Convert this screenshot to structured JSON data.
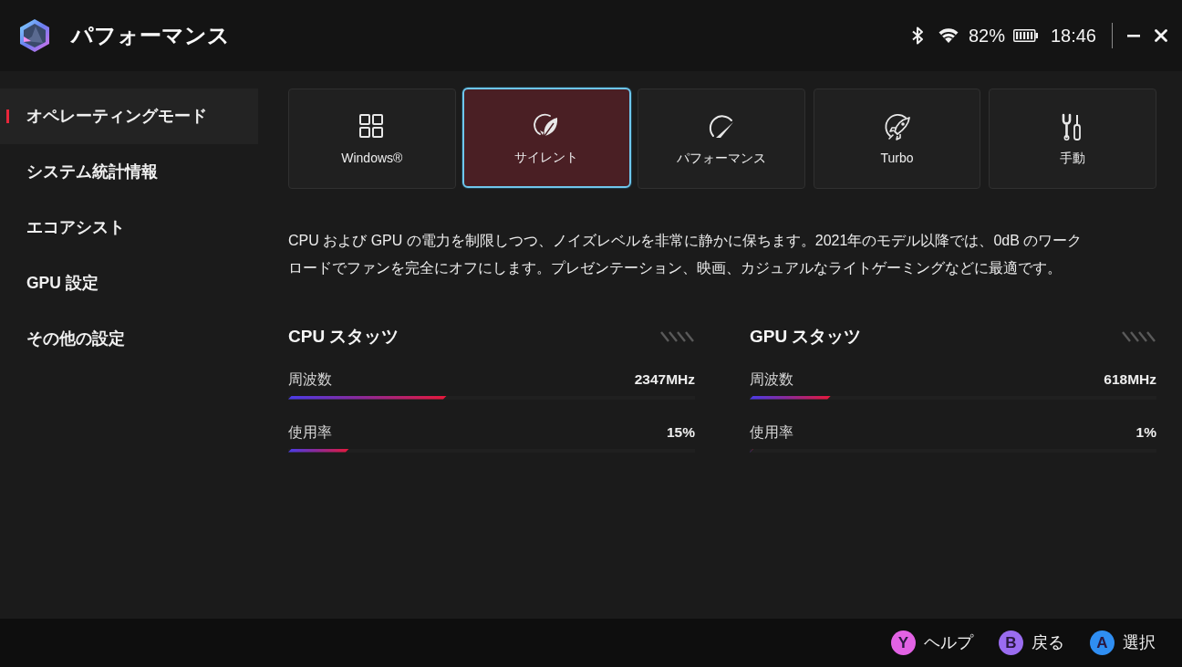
{
  "app": {
    "title": "パフォーマンス"
  },
  "status_bar": {
    "battery": "82%",
    "time": "18:46"
  },
  "sidebar": {
    "items": [
      {
        "label": "オペレーティングモード",
        "selected": true
      },
      {
        "label": "システム統計情報",
        "selected": false
      },
      {
        "label": "エコアシスト",
        "selected": false
      },
      {
        "label": "GPU 設定",
        "selected": false
      },
      {
        "label": "その他の設定",
        "selected": false
      }
    ]
  },
  "modes": [
    {
      "label": "Windows®",
      "selected": false
    },
    {
      "label": "サイレント",
      "selected": true
    },
    {
      "label": "パフォーマンス",
      "selected": false
    },
    {
      "label": "Turbo",
      "selected": false
    },
    {
      "label": "手動",
      "selected": false
    }
  ],
  "description": "CPU および GPU の電力を制限しつつ、ノイズレベルを非常に静かに保ちます。2021年のモデル以降では、0dB のワークロードでファンを完全にオフにします。プレゼンテーション、映画、カジュアルなライトゲーミングなどに最適です。",
  "stats": [
    {
      "title": "CPU スタッツ",
      "metrics": [
        {
          "label": "周波数",
          "reading": "2347MHz",
          "level": 0.39
        },
        {
          "label": "使用率",
          "reading": "15%",
          "level": 0.15
        }
      ]
    },
    {
      "title": "GPU スタッツ",
      "metrics": [
        {
          "label": "周波数",
          "reading": "618MHz",
          "level": 0.2
        },
        {
          "label": "使用率",
          "reading": "1%",
          "level": 0.01
        }
      ]
    }
  ],
  "footer": {
    "hints": [
      {
        "key": "Y",
        "label": "ヘルプ",
        "color": "#e262e4"
      },
      {
        "key": "B",
        "label": "戻る",
        "color": "#9a6cf0"
      },
      {
        "key": "A",
        "label": "選択",
        "color": "#2f8ef2"
      }
    ]
  }
}
